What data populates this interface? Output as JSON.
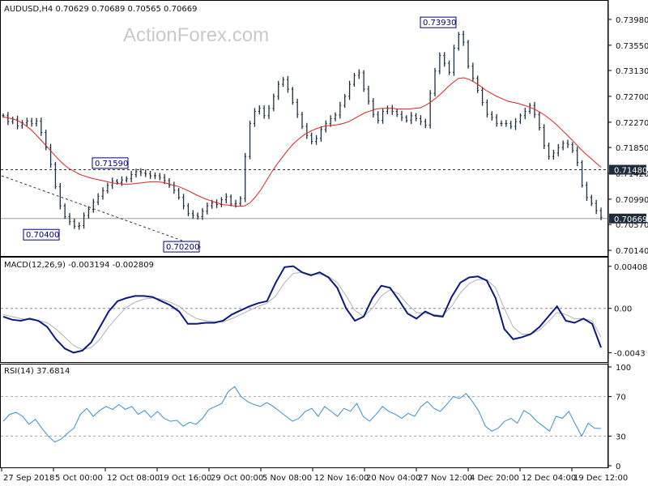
{
  "chart_data": [
    {
      "type": "line",
      "panel": "price",
      "header": "AUDUSD,H4  0.70629 0.70689 0.70565 0.70669",
      "watermark": "ActionForex.com",
      "ylim": [
        0.701,
        0.7406
      ],
      "y_ticks": [
        "0.73980",
        "0.73550",
        "0.73130",
        "0.72700",
        "0.72270",
        "0.71850",
        "0.71420",
        "0.70990",
        "0.70570",
        "0.70140"
      ],
      "hline_level": 0.7148,
      "hline_label": "0.71480",
      "last_level": 0.70669,
      "last_label": "0.70669",
      "price_series": [
        0.7238,
        0.7228,
        0.7232,
        0.7221,
        0.7226,
        0.7229,
        0.7225,
        0.7229,
        0.721,
        0.7185,
        0.7157,
        0.712,
        0.7088,
        0.707,
        0.7062,
        0.7054,
        0.7055,
        0.7072,
        0.7082,
        0.7094,
        0.7104,
        0.7113,
        0.7122,
        0.7129,
        0.7127,
        0.7131,
        0.7133,
        0.714,
        0.7145,
        0.7143,
        0.7141,
        0.7138,
        0.7138,
        0.7135,
        0.713,
        0.7122,
        0.7114,
        0.7102,
        0.7088,
        0.7075,
        0.7072,
        0.707,
        0.7079,
        0.7088,
        0.7093,
        0.709,
        0.7098,
        0.7103,
        0.7091,
        0.7092,
        0.71,
        0.717,
        0.7225,
        0.7245,
        0.725,
        0.7238,
        0.725,
        0.727,
        0.729,
        0.7298,
        0.7282,
        0.726,
        0.724,
        0.722,
        0.7205,
        0.7195,
        0.72,
        0.7215,
        0.7225,
        0.7233,
        0.7239,
        0.7255,
        0.727,
        0.729,
        0.7305,
        0.7309,
        0.7282,
        0.7262,
        0.724,
        0.723,
        0.7245,
        0.725,
        0.7245,
        0.724,
        0.7235,
        0.723,
        0.7238,
        0.7233,
        0.7228,
        0.7222,
        0.7275,
        0.7312,
        0.7338,
        0.7325,
        0.731,
        0.735,
        0.7373,
        0.736,
        0.732,
        0.73,
        0.728,
        0.726,
        0.724,
        0.7235,
        0.7225,
        0.7225,
        0.7225,
        0.722,
        0.7228,
        0.7238,
        0.7245,
        0.7255,
        0.724,
        0.7218,
        0.7188,
        0.717,
        0.7176,
        0.7185,
        0.7192,
        0.719,
        0.718,
        0.716,
        0.7122,
        0.7102,
        0.7092,
        0.708,
        0.7069
      ],
      "ma_series": [
        0.7236,
        0.7234,
        0.7232,
        0.7228,
        0.7222,
        0.7215,
        0.7206,
        0.7196,
        0.7186,
        0.7176,
        0.7166,
        0.7157,
        0.715,
        0.7145,
        0.714,
        0.7137,
        0.7134,
        0.7132,
        0.713,
        0.7128,
        0.7126,
        0.7125,
        0.7124,
        0.7124,
        0.7125,
        0.7126,
        0.7127,
        0.7128,
        0.7128,
        0.7127,
        0.7125,
        0.7122,
        0.712,
        0.7116,
        0.7112,
        0.7107,
        0.7103,
        0.7099,
        0.7096,
        0.7093,
        0.709,
        0.7089,
        0.7088,
        0.7087,
        0.7088,
        0.7093,
        0.7103,
        0.7115,
        0.713,
        0.7145,
        0.7158,
        0.717,
        0.7182,
        0.7192,
        0.72,
        0.7207,
        0.7212,
        0.7216,
        0.7219,
        0.7221,
        0.7222,
        0.7223,
        0.7225,
        0.7228,
        0.7233,
        0.7238,
        0.7243,
        0.7246,
        0.7249,
        0.725,
        0.725,
        0.725,
        0.7249,
        0.7249,
        0.7249,
        0.725,
        0.7251,
        0.7255,
        0.7261,
        0.7268,
        0.7276,
        0.7285,
        0.7293,
        0.73,
        0.7301,
        0.7298,
        0.7293,
        0.7287,
        0.728,
        0.7275,
        0.727,
        0.7266,
        0.7262,
        0.726,
        0.7258,
        0.7255,
        0.7252,
        0.7248,
        0.7243,
        0.7237,
        0.723,
        0.7222,
        0.7213,
        0.7204,
        0.7195,
        0.7185,
        0.7176,
        0.7168,
        0.716,
        0.7152
      ],
      "annotations": [
        "0.71590",
        "0.70400",
        "0.70200",
        "0.73930"
      ],
      "trendline_from": 0.7138,
      "trendline_to": 0.7018
    },
    {
      "type": "line",
      "panel": "macd",
      "header": "MACD(12,26,9) -0.003194 -0.002809",
      "ylim": [
        -0.0049,
        0.00438
      ],
      "y_ticks": [
        "0.004085",
        "0.00",
        "-0.0043"
      ],
      "zero_level": 0.0,
      "macd": [
        -0.0008,
        -0.0011,
        -0.0012,
        -0.001,
        -0.0012,
        -0.0018,
        -0.003,
        -0.0039,
        -0.0043,
        -0.0041,
        -0.0033,
        -0.0018,
        -0.0003,
        0.0007,
        0.001,
        0.0012,
        0.0012,
        0.0011,
        0.0007,
        0.0003,
        -0.0003,
        -0.0015,
        -0.0015,
        -0.0014,
        -0.0014,
        -0.0012,
        -0.0006,
        -0.0002,
        0.0002,
        0.0005,
        0.0007,
        0.0025,
        0.004,
        0.0041,
        0.0035,
        0.0032,
        0.0035,
        0.003,
        0.002,
        0.0,
        -0.0012,
        -0.0008,
        0.001,
        0.0022,
        0.002,
        0.0008,
        -0.0005,
        -0.001,
        -0.0003,
        -0.0007,
        -0.0008,
        0.0011,
        0.0025,
        0.003,
        0.0031,
        0.0027,
        0.001,
        -0.002,
        -0.003,
        -0.0028,
        -0.0025,
        -0.0018,
        -0.0008,
        0.0002,
        -0.0012,
        -0.0014,
        -0.001,
        -0.0015,
        -0.0038
      ],
      "signal": [
        -0.0006,
        -0.0008,
        -0.001,
        -0.0011,
        -0.0012,
        -0.0014,
        -0.002,
        -0.0028,
        -0.0036,
        -0.004,
        -0.0038,
        -0.003,
        -0.0018,
        -0.0008,
        0.0001,
        0.0006,
        0.0009,
        0.001,
        0.0009,
        0.0006,
        0.0002,
        -0.0005,
        -0.001,
        -0.0012,
        -0.0013,
        -0.0013,
        -0.001,
        -0.0006,
        -0.0002,
        0.0002,
        0.0005,
        0.0012,
        0.0025,
        0.0034,
        0.0035,
        0.0033,
        0.0033,
        0.0031,
        0.0025,
        0.0012,
        -0.0002,
        -0.0008,
        0.0,
        0.0012,
        0.0018,
        0.0014,
        0.0004,
        -0.0004,
        -0.0005,
        -0.0006,
        -0.0007,
        0.0002,
        0.0015,
        0.0024,
        0.0028,
        0.0028,
        0.002,
        0.0,
        -0.0018,
        -0.0025,
        -0.0025,
        -0.0021,
        -0.0013,
        -0.0004,
        -0.0006,
        -0.001,
        -0.001,
        -0.0012,
        -0.0028
      ]
    },
    {
      "type": "line",
      "panel": "rsi",
      "header": "RSI(14) 37.6814",
      "ylim": [
        0,
        100
      ],
      "y_ticks": [
        "100",
        "70",
        "30",
        "0"
      ],
      "levels": [
        70,
        30
      ],
      "rsi": [
        45,
        52,
        54,
        50,
        42,
        47,
        38,
        30,
        24,
        27,
        33,
        38,
        52,
        58,
        50,
        56,
        60,
        57,
        62,
        57,
        60,
        52,
        56,
        49,
        55,
        48,
        45,
        46,
        40,
        44,
        42,
        48,
        57,
        60,
        63,
        75,
        80,
        70,
        65,
        62,
        60,
        64,
        60,
        55,
        50,
        45,
        48,
        55,
        58,
        50,
        60,
        55,
        50,
        58,
        55,
        63,
        50,
        45,
        52,
        60,
        55,
        52,
        48,
        53,
        50,
        60,
        65,
        58,
        55,
        62,
        70,
        68,
        73,
        65,
        55,
        40,
        35,
        38,
        45,
        48,
        43,
        56,
        52,
        45,
        40,
        35,
        50,
        48,
        55,
        42,
        30,
        43,
        38,
        37.7
      ],
      "x_ticks": [
        "27 Sep 2018",
        "5 Oct 00:00",
        "12 Oct 08:00",
        "19 Oct 16:00",
        "29 Oct 00:00",
        "5 Nov 08:00",
        "12 Nov 16:00",
        "20 Nov 04:00",
        "27 Nov 12:00",
        "4 Dec 20:00",
        "12 Dec 04:00",
        "19 Dec 12:00"
      ]
    }
  ]
}
